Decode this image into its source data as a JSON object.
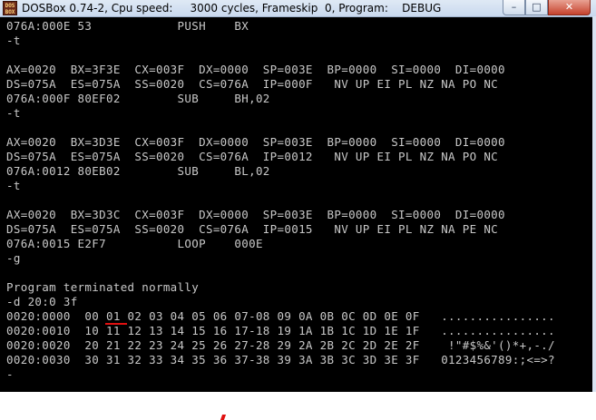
{
  "window": {
    "title": "DOSBox 0.74-2, Cpu speed:     3000 cycles, Frameskip  0, Program:    DEBUG",
    "icon_label": "DOS BOX",
    "icon": "dosbox-icon",
    "buttons": {
      "minimize": "–",
      "maximize": "□",
      "close": "✕"
    }
  },
  "console": {
    "lines": [
      "076A:000E 53            PUSH    BX",
      "-t",
      "",
      "AX=0020  BX=3F3E  CX=003F  DX=0000  SP=003E  BP=0000  SI=0000  DI=0000",
      "DS=075A  ES=075A  SS=0020  CS=076A  IP=000F   NV UP EI PL NZ NA PO NC",
      "076A:000F 80EF02        SUB     BH,02",
      "-t",
      "",
      "AX=0020  BX=3D3E  CX=003F  DX=0000  SP=003E  BP=0000  SI=0000  DI=0000",
      "DS=075A  ES=075A  SS=0020  CS=076A  IP=0012   NV UP EI PL NZ NA PO NC",
      "076A:0012 80EB02        SUB     BL,02",
      "-t",
      "",
      "AX=0020  BX=3D3C  CX=003F  DX=0000  SP=003E  BP=0000  SI=0000  DI=0000",
      "DS=075A  ES=075A  SS=0020  CS=076A  IP=0015   NV UP EI PL NZ NA PE NC",
      "076A:0015 E2F7          LOOP    000E",
      "-g",
      "",
      "Program terminated normally",
      "-d 20:0 3f",
      "0020:0000  00 01 02 03 04 05 06 07-08 09 0A 0B 0C 0D 0E 0F   ................",
      "0020:0010  10 11 12 13 14 15 16 17-18 19 1A 1B 1C 1D 1E 1F   ................",
      "0020:0020  20 21 22 23 24 25 26 27-28 29 2A 2B 2C 2D 2E 2F    !\"#$%&'()*+,-./",
      "0020:0030  30 31 32 33 34 35 36 37-38 39 3A 3B 3C 3D 3E 3F   0123456789:;<=>?",
      "-"
    ]
  },
  "colors": {
    "console_bg": "#000000",
    "console_text": "#c8c8c8",
    "annotation": "#e01010"
  }
}
